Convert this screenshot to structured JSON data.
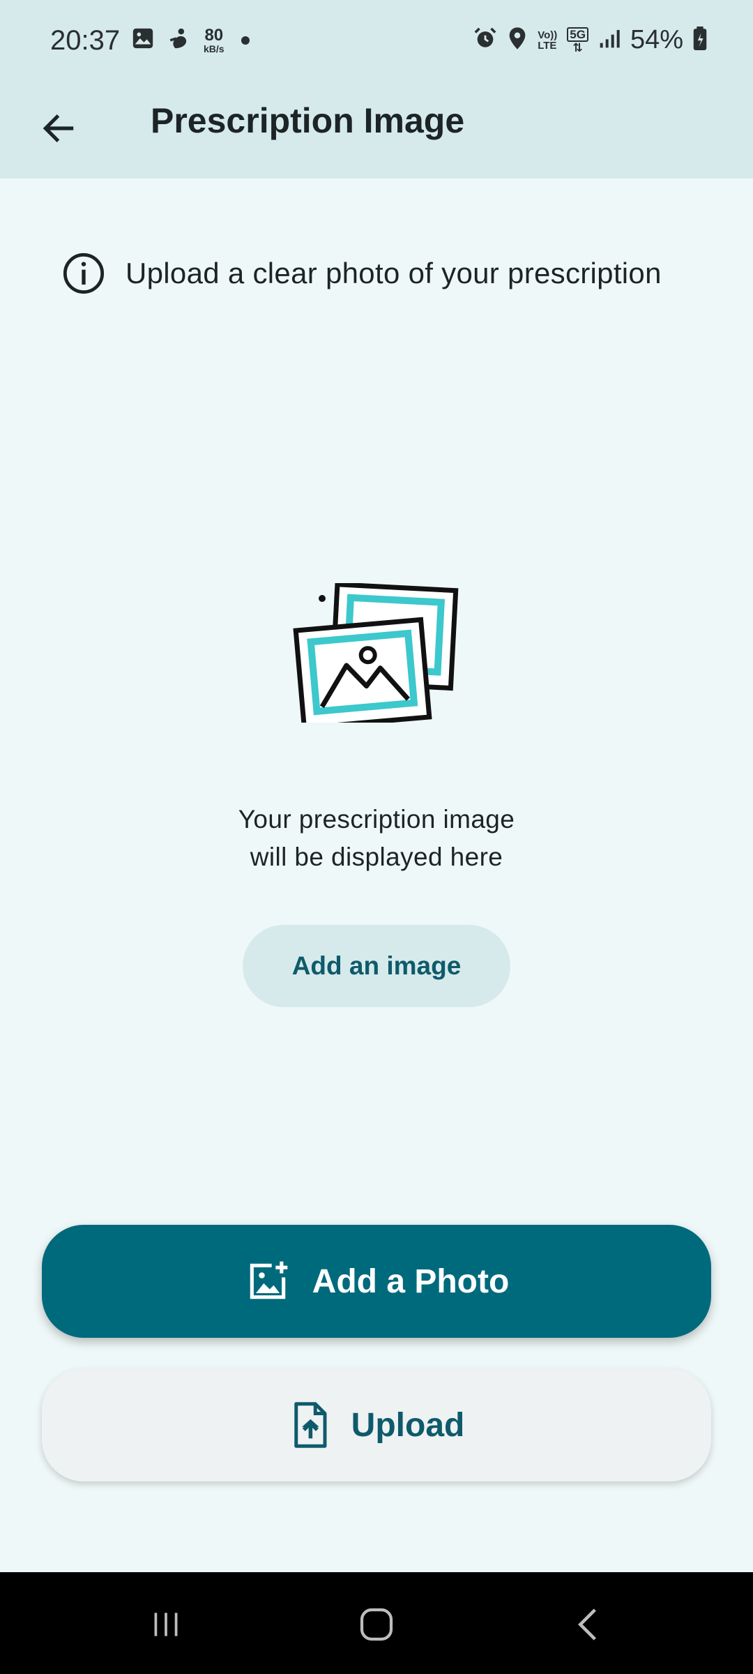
{
  "status_bar": {
    "time": "20:37",
    "network_speed_value": "80",
    "network_speed_unit": "kB/s",
    "volte_top": "Vo))",
    "volte_bottom": "LTE",
    "network_type": "5G",
    "battery": "54%",
    "icons": [
      "gallery-icon",
      "bixby-icon",
      "alarm-icon",
      "location-icon",
      "signal-icon",
      "battery-icon"
    ]
  },
  "app_bar": {
    "title": "Prescription Image",
    "back_icon": "arrow-back-icon"
  },
  "info": {
    "icon": "info-icon",
    "text": "Upload a clear photo of your prescription"
  },
  "placeholder": {
    "illustration": "photo-stack-illustration",
    "line1": "Your prescription image",
    "line2": "will be displayed here",
    "add_image_label": "Add an image"
  },
  "actions": {
    "add_photo": {
      "label": "Add a Photo",
      "icon": "add-photo-icon"
    },
    "upload": {
      "label": "Upload",
      "icon": "file-upload-icon"
    }
  },
  "nav_bar": {
    "buttons": [
      "recent-apps-icon",
      "home-icon",
      "back-icon"
    ]
  },
  "colors": {
    "header_bg": "#d6eaeb",
    "page_bg": "#eff8f8",
    "primary": "#006a7d",
    "primary_text": "#0e5a6b",
    "illustration_accent": "#3cc8cc"
  }
}
